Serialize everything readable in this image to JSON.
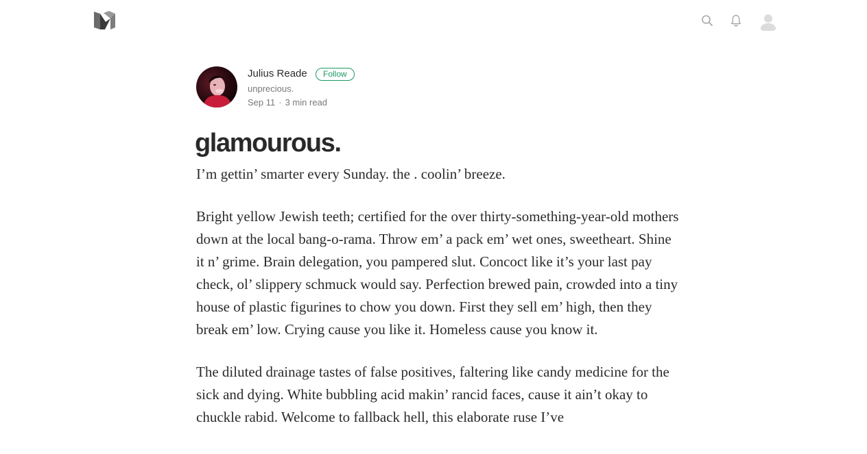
{
  "nav": {
    "logo_icon": "medium-logo-icon",
    "search_icon": "search-icon",
    "notifications_icon": "bell-icon",
    "user_avatar_icon": "user-avatar-icon"
  },
  "author": {
    "name": "Julius Reade",
    "follow_label": "Follow",
    "bio": "unprecious.",
    "date": "Sep 11",
    "separator": "·",
    "read_time": "3 min read"
  },
  "article": {
    "title": "glamourous.",
    "paragraphs": [
      "I’m gettin’ smarter every Sunday. the . coolin’ breeze.",
      "Bright yellow Jewish teeth; certified for the over thirty-something-year-old mothers down at the local bang-o-rama. Throw em’ a pack em’ wet ones, sweetheart. Shine it n’ grime. Brain delegation, you pampered slut. Concoct like it’s your last pay check, ol’ slippery schmuck would say. Perfection brewed pain, crowded into a tiny house of plastic figurines to chow you down. First they sell em’ high, then they break em’ low. Crying cause you like it. Homeless cause you know it.",
      "The diluted drainage tastes of false positives, faltering like candy medicine for the sick and dying. White bubbling acid makin’ rancid faces, cause it ain’t okay to chuckle rabid. Welcome to fallback hell, this elaborate ruse I’ve"
    ]
  },
  "colors": {
    "accent_green": "#1c9963",
    "text_primary": "rgba(0,0,0,0.84)",
    "text_secondary": "rgba(0,0,0,0.54)",
    "icon_gray": "#a8a8a8"
  }
}
